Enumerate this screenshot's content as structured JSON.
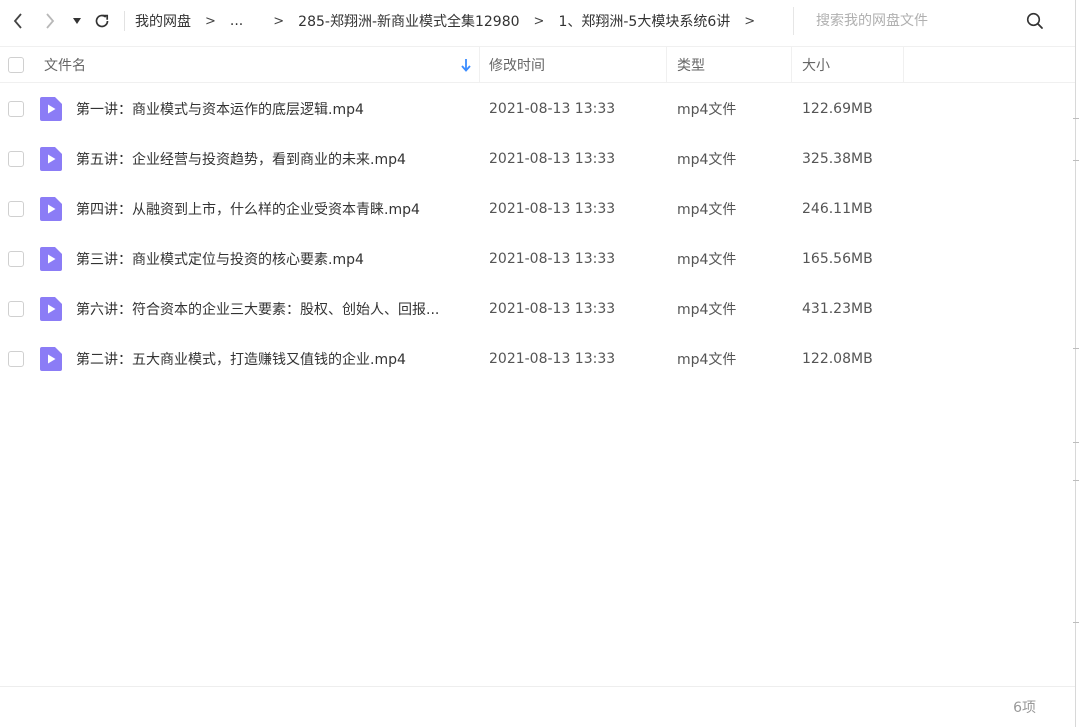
{
  "toolbar": {
    "back_icon": "chevron-left-icon",
    "forward_icon": "chevron-right-icon",
    "history_icon": "caret-down-icon",
    "refresh_icon": "refresh-icon"
  },
  "breadcrumb": {
    "items": [
      "我的网盘",
      "...",
      "285-郑翔洲-新商业模式全集12980",
      "1、郑翔洲-5大模块系统6讲"
    ],
    "separator": ">"
  },
  "search": {
    "placeholder": "搜索我的网盘文件",
    "value": "",
    "icon": "search-icon"
  },
  "table": {
    "columns": {
      "name": "文件名",
      "mtime": "修改时间",
      "type": "类型",
      "size": "大小"
    },
    "sort_icon": "arrow-down-icon",
    "file_icon": "video-file-icon",
    "accent_color": "#8b7cf6",
    "rows": [
      {
        "name": "第一讲：商业模式与资本运作的底层逻辑.mp4",
        "mtime": "2021-08-13 13:33",
        "type": "mp4文件",
        "size": "122.69MB"
      },
      {
        "name": "第五讲：企业经营与投资趋势，看到商业的未来.mp4",
        "mtime": "2021-08-13 13:33",
        "type": "mp4文件",
        "size": "325.38MB"
      },
      {
        "name": "第四讲：从融资到上市，什么样的企业受资本青睐.mp4",
        "mtime": "2021-08-13 13:33",
        "type": "mp4文件",
        "size": "246.11MB"
      },
      {
        "name": "第三讲：商业模式定位与投资的核心要素.mp4",
        "mtime": "2021-08-13 13:33",
        "type": "mp4文件",
        "size": "165.56MB"
      },
      {
        "name": "第六讲：符合资本的企业三大要素：股权、创始人、回报...",
        "mtime": "2021-08-13 13:33",
        "type": "mp4文件",
        "size": "431.23MB"
      },
      {
        "name": "第二讲：五大商业模式，打造赚钱又值钱的企业.mp4",
        "mtime": "2021-08-13 13:33",
        "type": "mp4文件",
        "size": "122.08MB"
      }
    ]
  },
  "footer": {
    "count": "6项"
  }
}
